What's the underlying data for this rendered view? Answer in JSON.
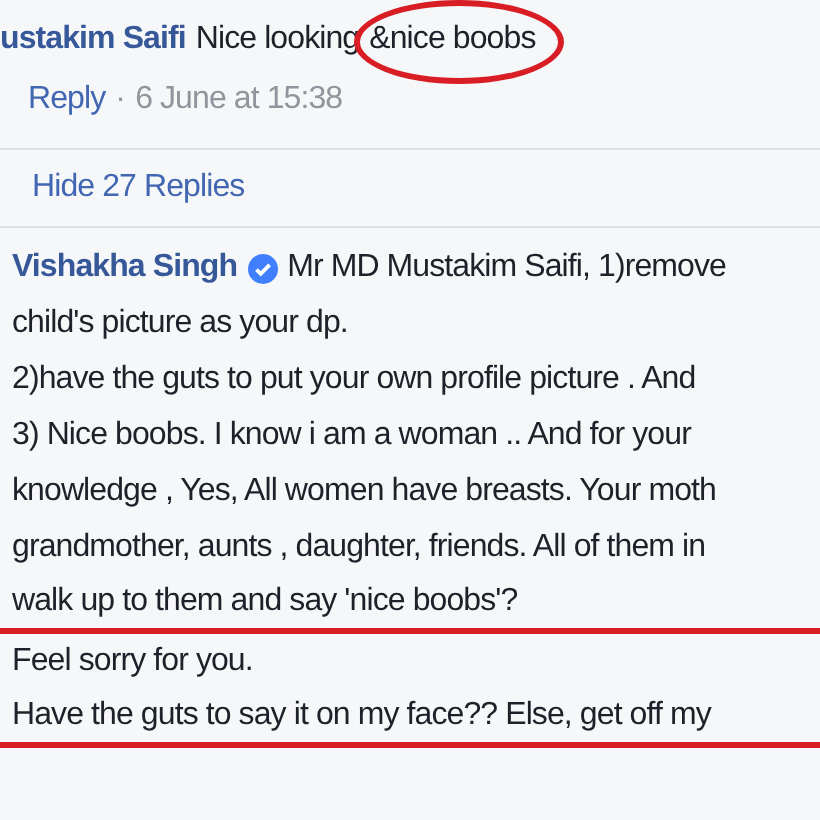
{
  "comment": {
    "author": "ustakim Saifi",
    "text_parts": [
      {
        "text": "Nice looking",
        "circled": false
      },
      {
        "text": "&nice boobs",
        "circled": true
      }
    ],
    "actions": {
      "link": "Reply",
      "separator": "·",
      "time": "6 June at 15:38"
    }
  },
  "replies_toggle": {
    "label": "Hide 27 Replies"
  },
  "reply": {
    "author": "Vishakha Singh",
    "verified": true,
    "lines": [
      {
        "text": "Mr MD Mustakim Saifi, 1)remove",
        "underlined": false
      },
      {
        "text": "child's picture as your dp.",
        "underlined": false
      },
      {
        "text": "2)have the guts to put your own profile picture . And",
        "underlined": false
      },
      {
        "text": "3) Nice boobs. I know i am a woman .. And for your",
        "underlined": false
      },
      {
        "text": "knowledge , Yes, All women have breasts. Your moth",
        "underlined": false
      },
      {
        "text": "grandmother, aunts , daughter, friends. All of them in",
        "underlined": false
      },
      {
        "text": "walk up to them and say 'nice boobs'?",
        "underlined": true
      },
      {
        "text": "Feel sorry for you.",
        "underlined": false
      },
      {
        "text": "Have the guts to say it on my face?? Else, get off my",
        "underlined": true
      }
    ]
  }
}
